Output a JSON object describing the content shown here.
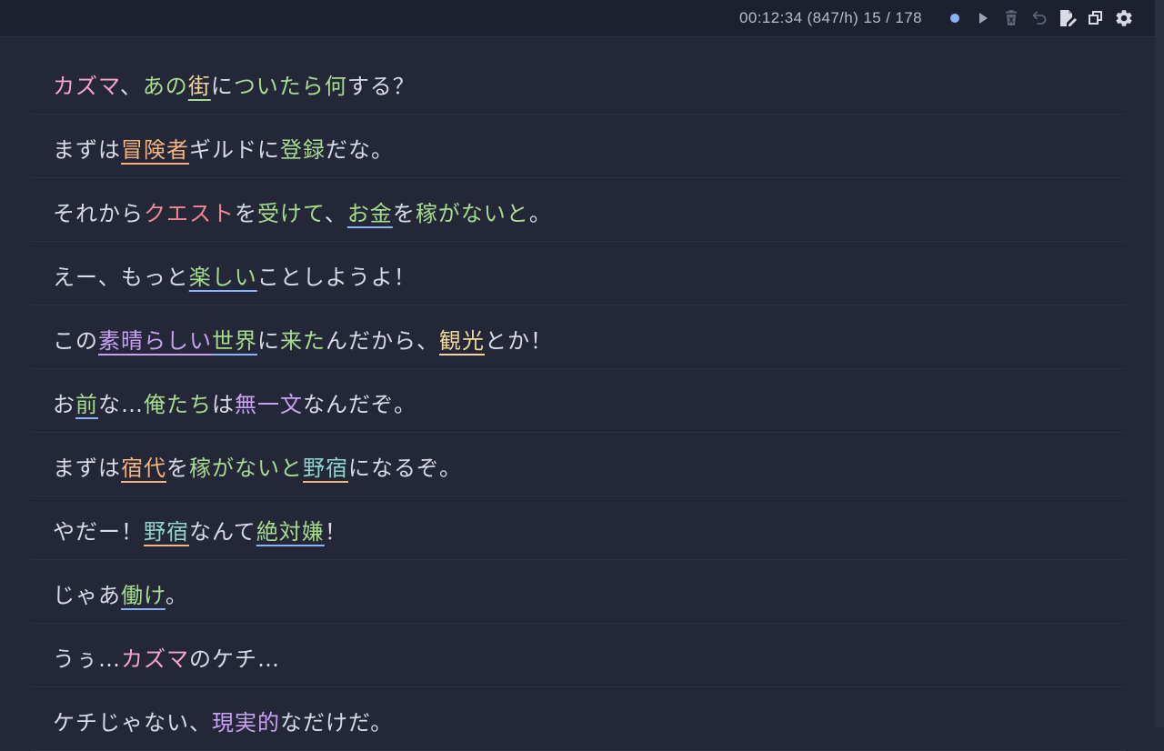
{
  "header": {
    "elapsed": "00:12:34",
    "rate": "(847/h)",
    "progress": "15 / 178",
    "icons": [
      "status-dot-icon",
      "play-icon",
      "trash-icon",
      "undo-icon",
      "edit-document-icon",
      "window-restore-icon",
      "gear-icon"
    ]
  },
  "colors": {
    "pink": "#f5a5c8",
    "green": "#a6dc8e",
    "orange": "#f5b37c",
    "red": "#ee8a8e",
    "purple": "#c8a2f0",
    "yellow": "#f2d89a",
    "teal": "#8fd3c9",
    "blue": "#8ab4f8",
    "plain": "#d8dbe6"
  },
  "lines": [
    {
      "segments": [
        {
          "text": "カズマ",
          "color": "pink"
        },
        {
          "text": "、"
        },
        {
          "text": "あの",
          "color": "green"
        },
        {
          "text": "街",
          "color": "yellow",
          "underline": "green"
        },
        {
          "text": "に"
        },
        {
          "text": "ついたら",
          "color": "green"
        },
        {
          "text": "何",
          "color": "green"
        },
        {
          "text": "する？"
        }
      ]
    },
    {
      "segments": [
        {
          "text": "まずは"
        },
        {
          "text": "冒険者",
          "color": "orange",
          "underline": "orange"
        },
        {
          "text": "ギルドに"
        },
        {
          "text": "登録",
          "color": "green"
        },
        {
          "text": "だな。"
        }
      ]
    },
    {
      "segments": [
        {
          "text": "それから"
        },
        {
          "text": "クエスト",
          "color": "red"
        },
        {
          "text": "を"
        },
        {
          "text": "受けて",
          "color": "green"
        },
        {
          "text": "、"
        },
        {
          "text": "お金",
          "color": "green",
          "underline": "blue"
        },
        {
          "text": "を"
        },
        {
          "text": "稼がないと",
          "color": "green"
        },
        {
          "text": "。"
        }
      ]
    },
    {
      "segments": [
        {
          "text": "えー、もっと"
        },
        {
          "text": "楽しい",
          "color": "green",
          "underline": "blue"
        },
        {
          "text": "ことしようよ！"
        }
      ]
    },
    {
      "segments": [
        {
          "text": "この"
        },
        {
          "text": "素晴らしい",
          "color": "purple",
          "underline": "purple"
        },
        {
          "text": "世界",
          "color": "green",
          "underline": "blue"
        },
        {
          "text": "に"
        },
        {
          "text": "来た",
          "color": "green"
        },
        {
          "text": "んだから、"
        },
        {
          "text": "観光",
          "color": "yellow",
          "underline": "yellow"
        },
        {
          "text": "とか！"
        }
      ]
    },
    {
      "segments": [
        {
          "text": "お"
        },
        {
          "text": "前",
          "color": "green",
          "underline": "blue"
        },
        {
          "text": "な…"
        },
        {
          "text": "俺たち",
          "color": "green"
        },
        {
          "text": "は"
        },
        {
          "text": "無一文",
          "color": "purple"
        },
        {
          "text": "なんだぞ。"
        }
      ]
    },
    {
      "segments": [
        {
          "text": "まずは"
        },
        {
          "text": "宿代",
          "color": "orange",
          "underline": "orange"
        },
        {
          "text": "を"
        },
        {
          "text": "稼がないと",
          "color": "green"
        },
        {
          "text": "野宿",
          "color": "teal",
          "underline": "orange"
        },
        {
          "text": "になるぞ。"
        }
      ]
    },
    {
      "segments": [
        {
          "text": "やだー！"
        },
        {
          "text": "野宿",
          "color": "teal",
          "underline": "orange"
        },
        {
          "text": "なんて"
        },
        {
          "text": "絶対嫌",
          "color": "green",
          "underline": "blue"
        },
        {
          "text": "！"
        }
      ]
    },
    {
      "segments": [
        {
          "text": "じゃあ"
        },
        {
          "text": "働け",
          "color": "green",
          "underline": "blue"
        },
        {
          "text": "。"
        }
      ]
    },
    {
      "segments": [
        {
          "text": "うぅ…"
        },
        {
          "text": "カズマ",
          "color": "pink"
        },
        {
          "text": "のケチ…"
        }
      ]
    },
    {
      "segments": [
        {
          "text": "ケチじゃない、"
        },
        {
          "text": "現実的",
          "color": "purple"
        },
        {
          "text": "なだけだ。"
        }
      ]
    }
  ]
}
